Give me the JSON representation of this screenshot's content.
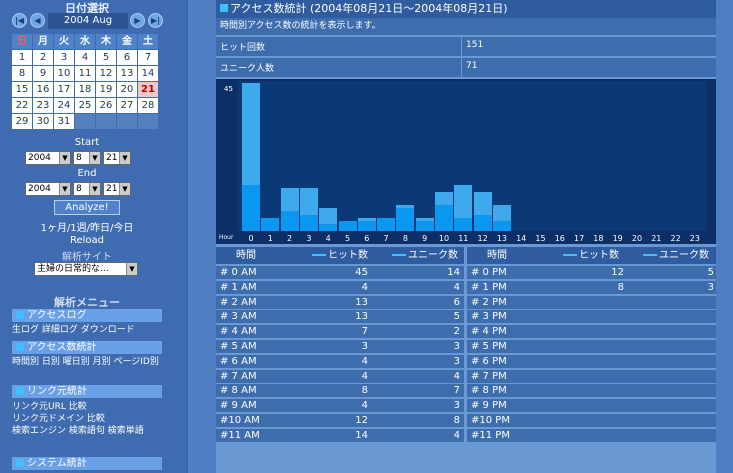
{
  "sidebar": {
    "cal_title": "日付選択",
    "nav": {
      "first": "|◀",
      "prev": "◀",
      "next": "▶",
      "last": "▶|"
    },
    "month": "2004 Aug",
    "weekdays": [
      "日",
      "月",
      "火",
      "水",
      "木",
      "金",
      "土"
    ],
    "weeks": [
      [
        "1",
        "2",
        "3",
        "4",
        "5",
        "6",
        "7"
      ],
      [
        "8",
        "9",
        "10",
        "11",
        "12",
        "13",
        "14"
      ],
      [
        "15",
        "16",
        "17",
        "18",
        "19",
        "20",
        "21"
      ],
      [
        "22",
        "23",
        "24",
        "25",
        "26",
        "27",
        "28"
      ],
      [
        "29",
        "30",
        "31",
        "",
        "",
        "",
        ""
      ]
    ],
    "today": "21",
    "start_label": "Start",
    "end_label": "End",
    "start": {
      "year": "2004",
      "month": "8",
      "day": "21"
    },
    "end": {
      "year": "2004",
      "month": "8",
      "day": "21"
    },
    "analyze": "Analyze!",
    "range_links": "1ヶ月/1週/昨日/今日",
    "reload": "Reload",
    "site_label": "解析サイト",
    "site_value": "主婦の日常的な...",
    "menu_title": "解析メニュー",
    "menus": [
      {
        "title": "アクセスログ",
        "links": "生ログ 詳細ログ ダウンロード"
      },
      {
        "title": "アクセス数統計",
        "links": "時間別 日別 曜日別 月別 ページID別"
      },
      {
        "title": "リンク元統計",
        "links": "リンク元URL 比較\nリンク元ドメイン 比較\n検索エンジン 検索語句 検索単語"
      },
      {
        "title": "システム統計",
        "links": ""
      }
    ]
  },
  "main": {
    "title": "アクセス数統計 (2004年08月21日～2004年08月21日)",
    "description": "時間別アクセス数の統計を表示します。",
    "summary": [
      {
        "label": "ヒット回数",
        "value": "151"
      },
      {
        "label": "ユニーク人数",
        "value": "71"
      }
    ],
    "table_headers": {
      "time": "時間",
      "hits": "ヒット数",
      "unique": "ユニーク数"
    },
    "am_rows": [
      {
        "time": "# 0 AM",
        "hits": "45",
        "unique": "14"
      },
      {
        "time": "# 1 AM",
        "hits": "4",
        "unique": "4"
      },
      {
        "time": "# 2 AM",
        "hits": "13",
        "unique": "6"
      },
      {
        "time": "# 3 AM",
        "hits": "13",
        "unique": "5"
      },
      {
        "time": "# 4 AM",
        "hits": "7",
        "unique": "2"
      },
      {
        "time": "# 5 AM",
        "hits": "3",
        "unique": "3"
      },
      {
        "time": "# 6 AM",
        "hits": "4",
        "unique": "3"
      },
      {
        "time": "# 7 AM",
        "hits": "4",
        "unique": "4"
      },
      {
        "time": "# 8 AM",
        "hits": "8",
        "unique": "7"
      },
      {
        "time": "# 9 AM",
        "hits": "4",
        "unique": "3"
      },
      {
        "time": "#10 AM",
        "hits": "12",
        "unique": "8"
      },
      {
        "time": "#11 AM",
        "hits": "14",
        "unique": "4"
      }
    ],
    "pm_rows": [
      {
        "time": "# 0 PM",
        "hits": "12",
        "unique": "5"
      },
      {
        "time": "# 1 PM",
        "hits": "8",
        "unique": "3"
      },
      {
        "time": "# 2 PM",
        "hits": "",
        "unique": ""
      },
      {
        "time": "# 3 PM",
        "hits": "",
        "unique": ""
      },
      {
        "time": "# 4 PM",
        "hits": "",
        "unique": ""
      },
      {
        "time": "# 5 PM",
        "hits": "",
        "unique": ""
      },
      {
        "time": "# 6 PM",
        "hits": "",
        "unique": ""
      },
      {
        "time": "# 7 PM",
        "hits": "",
        "unique": ""
      },
      {
        "time": "# 8 PM",
        "hits": "",
        "unique": ""
      },
      {
        "time": "# 9 PM",
        "hits": "",
        "unique": ""
      },
      {
        "time": "#10 PM",
        "hits": "",
        "unique": ""
      },
      {
        "time": "#11 PM",
        "hits": "",
        "unique": ""
      }
    ]
  },
  "chart_data": {
    "type": "bar",
    "ymax_label": "45",
    "xlabel": "Hour",
    "ylim": [
      0,
      45
    ],
    "categories": [
      "0",
      "1",
      "2",
      "3",
      "4",
      "5",
      "6",
      "7",
      "8",
      "9",
      "10",
      "11",
      "12",
      "13",
      "14",
      "15",
      "16",
      "17",
      "18",
      "19",
      "20",
      "21",
      "22",
      "23"
    ],
    "series": [
      {
        "values": [
          45,
          4,
          13,
          13,
          7,
          3,
          4,
          4,
          8,
          4,
          12,
          14,
          12,
          8,
          0,
          0,
          0,
          0,
          0,
          0,
          0,
          0,
          0,
          0
        ]
      },
      {
        "values": [
          14,
          4,
          6,
          5,
          2,
          3,
          3,
          4,
          7,
          3,
          8,
          4,
          5,
          3,
          0,
          0,
          0,
          0,
          0,
          0,
          0,
          0,
          0,
          0
        ]
      }
    ],
    "colors": [
      "#3fa9ee",
      "#0a97f0"
    ]
  }
}
